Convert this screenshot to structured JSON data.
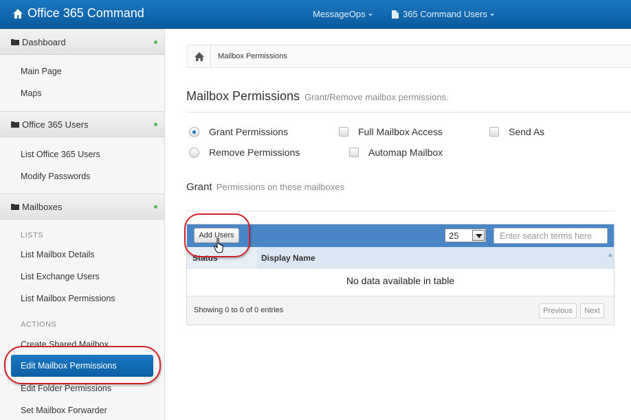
{
  "app": {
    "title": "Office 365 Command"
  },
  "topnav": {
    "tenant": "MessageOps",
    "users_menu": "365 Command Users"
  },
  "sidebar": {
    "sections": [
      {
        "label": "Dashboard",
        "items": [
          "Main Page",
          "Maps"
        ]
      },
      {
        "label": "Office 365 Users",
        "items": [
          "List Office 365 Users",
          "Modify Passwords"
        ]
      },
      {
        "label": "Mailboxes"
      }
    ],
    "lists_label": "LISTS",
    "lists_items": [
      "List Mailbox Details",
      "List Exchange Users",
      "List Mailbox Permissions"
    ],
    "actions_label": "ACTIONS",
    "actions_items": [
      "Create Shared Mailbox",
      "Edit Mailbox Permissions",
      "Edit Folder Permissions",
      "Set Mailbox Forwarder"
    ],
    "active_item": "Edit Mailbox Permissions"
  },
  "breadcrumb": {
    "current": "Mailbox Permissions"
  },
  "page": {
    "title": "Mailbox Permissions",
    "subtitle": "Grant/Remove mailbox permissions."
  },
  "options": {
    "grant": "Grant Permissions",
    "remove": "Remove Permissions",
    "full_access": "Full Mailbox Access",
    "automap": "Automap Mailbox",
    "send_as": "Send As",
    "selected_mode": "grant"
  },
  "grant_section": {
    "title": "Grant",
    "subtitle": "Permissions on these mailboxes"
  },
  "table": {
    "add_button": "Add Users",
    "page_length": "25",
    "search_placeholder": "Enter search terms here",
    "columns": [
      "Status",
      "Display Name"
    ],
    "empty_message": "No data available in table",
    "info": "Showing 0 to 0 of 0 entries",
    "prev": "Previous",
    "next": "Next"
  },
  "colors": {
    "topbar": "#0f66ab",
    "active": "#1a78c2",
    "toolbar": "#4a86c6",
    "highlight": "#d11f26",
    "status_dot": "#5cb85c"
  }
}
